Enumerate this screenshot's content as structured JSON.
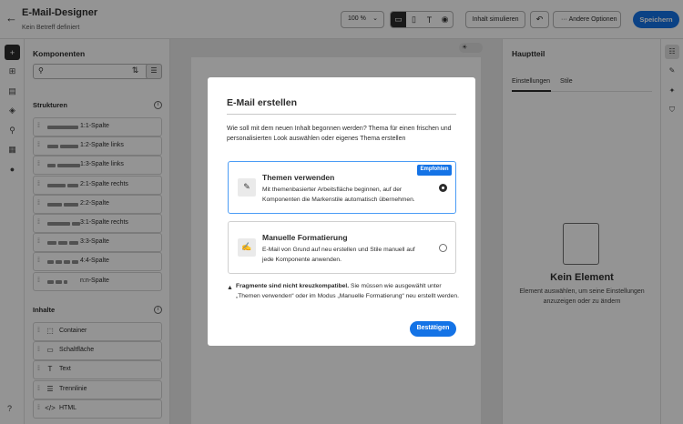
{
  "header": {
    "back_icon": "arrow-left-icon",
    "title": "E-Mail-Designer",
    "subtitle": "Kein Betreff definiert",
    "zoom": "100 %",
    "view_icons": [
      "desktop-icon",
      "mobile-icon",
      "text-icon",
      "eye-icon"
    ],
    "simulate_label": "Inhalt simulieren",
    "more_label": "Andere Optionen",
    "save_label": "Speichern"
  },
  "components": {
    "title": "Komponenten",
    "search_placeholder": "",
    "structures_title": "Strukturen",
    "structures": [
      {
        "label": "1:1-Spalte",
        "bars": [
          34
        ]
      },
      {
        "label": "1:2-Spalte links",
        "bars": [
          12,
          20
        ]
      },
      {
        "label": "1:3-Spalte links",
        "bars": [
          9,
          25
        ]
      },
      {
        "label": "2:1-Spalte rechts",
        "bars": [
          20,
          12
        ]
      },
      {
        "label": "2:2-Spalte",
        "bars": [
          16,
          16
        ]
      },
      {
        "label": "3:1-Spalte rechts",
        "bars": [
          25,
          9
        ]
      },
      {
        "label": "3:3-Spalte",
        "bars": [
          10,
          10,
          10
        ]
      },
      {
        "label": "4:4-Spalte",
        "bars": [
          7,
          7,
          7,
          7
        ]
      },
      {
        "label": "n:n-Spalte",
        "bars": [
          7,
          7,
          4
        ]
      }
    ],
    "contents_title": "Inhalte",
    "contents": [
      {
        "label": "Container",
        "icon": "container-icon",
        "glyph": "⬚"
      },
      {
        "label": "Schaltfläche",
        "icon": "button-icon",
        "glyph": "▭"
      },
      {
        "label": "Text",
        "icon": "text-icon",
        "glyph": "T"
      },
      {
        "label": "Trennlinie",
        "icon": "divider-icon",
        "glyph": "☰"
      },
      {
        "label": "HTML",
        "icon": "code-icon",
        "glyph": "</>"
      }
    ]
  },
  "right_panel": {
    "title": "Hauptteil",
    "tabs": [
      "Einstellungen",
      "Stile"
    ],
    "empty_title": "Kein Element",
    "empty_desc": "Element auswählen, um seine Einstellungen anzuzeigen oder zu ändern"
  },
  "modal": {
    "title": "E-Mail erstellen",
    "description": "Wie soll mit dem neuen Inhalt begonnen werden? Thema für einen frischen und personalisierten Look auswählen oder eigenes Thema erstellen",
    "option1": {
      "title": "Themen verwenden",
      "description": "Mit themenbasierter Arbeitsfläche beginnen, auf der Komponenten die Markenstile automatisch übernehmen.",
      "badge": "Empfohlen",
      "selected": true
    },
    "option2": {
      "title": "Manuelle Formatierung",
      "description": "E-Mail von Grund auf neu erstellen und Stile manuell auf jede Komponente anwenden.",
      "selected": false
    },
    "warning_bold": "Fragmente sind nicht kreuzkompatibel.",
    "warning_text": " Sie müssen wie ausgewählt unter „Themen verwenden“ oder im Modus „Manuelle Formatierung“ neu erstellt werden.",
    "confirm_label": "Bestätigen"
  },
  "colors": {
    "accent": "#1473e6",
    "selected_border": "#4b9cf5"
  }
}
